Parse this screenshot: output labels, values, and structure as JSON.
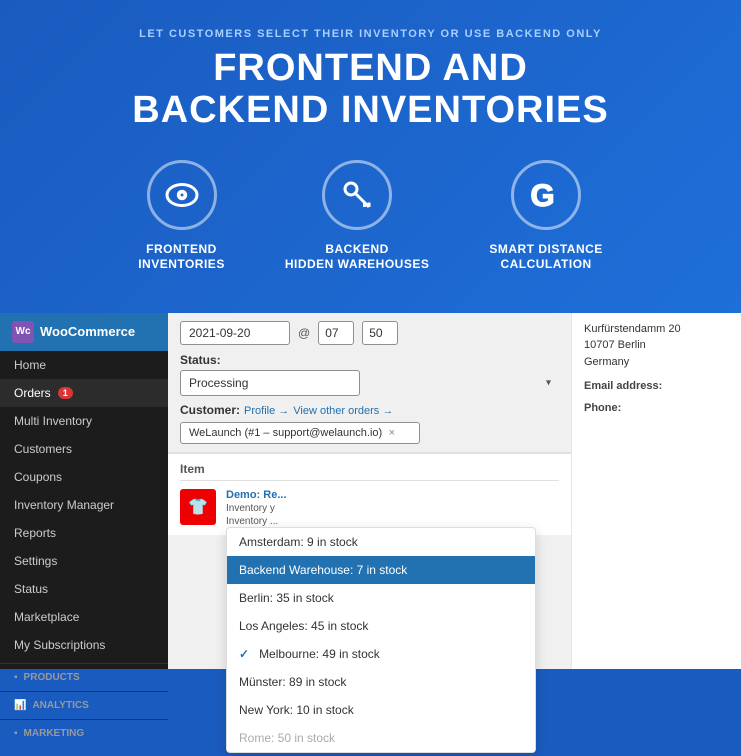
{
  "header": {
    "subtitle": "Let customers select their inventory or use backend only",
    "title_line1": "Frontend and",
    "title_line2": "Backend Inventories"
  },
  "features": [
    {
      "id": "frontend-inventories",
      "icon": "eye-icon",
      "label_line1": "Frontend",
      "label_line2": "Inventories"
    },
    {
      "id": "backend-warehouses",
      "icon": "key-icon",
      "label_line1": "Backend",
      "label_line2": "Hidden Warehouses"
    },
    {
      "id": "smart-distance",
      "icon": "google-icon",
      "label_line1": "Smart Distance",
      "label_line2": "Calculation"
    }
  ],
  "woocommerce": {
    "brand": "WooCommerce",
    "menu": [
      {
        "label": "Home",
        "active": false,
        "badge": null
      },
      {
        "label": "Orders",
        "active": true,
        "badge": "1"
      },
      {
        "label": "Multi Inventory",
        "active": false,
        "badge": null
      },
      {
        "label": "Customers",
        "active": false,
        "badge": null
      },
      {
        "label": "Coupons",
        "active": false,
        "badge": null
      },
      {
        "label": "Inventory Manager",
        "active": false,
        "badge": null
      },
      {
        "label": "Reports",
        "active": false,
        "badge": null
      },
      {
        "label": "Settings",
        "active": false,
        "badge": null
      },
      {
        "label": "Status",
        "active": false,
        "badge": null
      },
      {
        "label": "Marketplace",
        "active": false,
        "badge": null
      },
      {
        "label": "My Subscriptions",
        "active": false,
        "badge": null
      }
    ],
    "sections": [
      {
        "label": "Products"
      },
      {
        "label": "Analytics"
      },
      {
        "label": "Marketing"
      }
    ]
  },
  "order_form": {
    "date_value": "2021-09-20",
    "at_symbol": "@",
    "time_hour": "07",
    "time_min": "50",
    "status_label": "Status:",
    "status_value": "Processing",
    "customer_label": "Customer:",
    "profile_link": "Profile →",
    "view_orders_link": "View other orders →",
    "customer_value": "WeLaunch (#1 – support@welaunch.io)",
    "customer_x": "×"
  },
  "billing": {
    "address": "Kurfürstendamm 20\n10707 Berlin\nGermany",
    "email_label": "Email address:",
    "phone_label": "Phone:"
  },
  "order_items": {
    "column_item": "Item",
    "product_name": "Demo: Re...",
    "inventory_label1": "Inventory y",
    "inventory_label2": "Inventory ..."
  },
  "inventory_dropdown": {
    "items": [
      {
        "label": "Amsterdam: 9 in stock",
        "selected": false,
        "checked": false
      },
      {
        "label": "Backend Warehouse: 7 in stock",
        "selected": true,
        "checked": false
      },
      {
        "label": "Berlin: 35 in stock",
        "selected": false,
        "checked": false
      },
      {
        "label": "Los Angeles: 45 in stock",
        "selected": false,
        "checked": false
      },
      {
        "label": "Melbourne: 49 in stock",
        "selected": false,
        "checked": true
      },
      {
        "label": "Münster: 89 in stock",
        "selected": false,
        "checked": false
      },
      {
        "label": "New York: 10 in stock",
        "selected": false,
        "checked": false
      },
      {
        "label": "Rome: 50 in stock",
        "selected": false,
        "checked": false
      }
    ]
  }
}
